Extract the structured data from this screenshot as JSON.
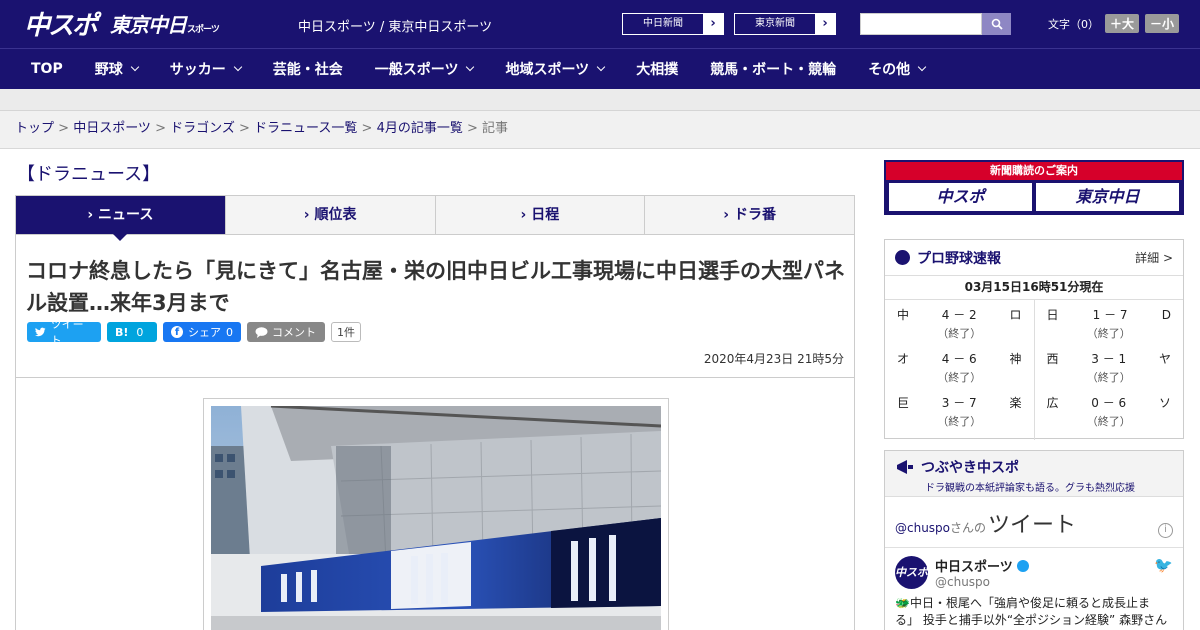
{
  "header": {
    "logo_main": "中スポ",
    "logo_sub": "東京中日",
    "logo_sub_small": "スポーツ",
    "site_links": "中日スポーツ / 東京中日スポーツ",
    "newspaper_btn_1": "中日新聞",
    "newspaper_btn_2": "東京新聞",
    "search_placeholder": "",
    "font_label": "文字（0）",
    "font_bigger": "＋大",
    "font_smaller": "－小"
  },
  "nav": {
    "items": [
      {
        "label": "TOP",
        "dropdown": false
      },
      {
        "label": "野球",
        "dropdown": true
      },
      {
        "label": "サッカー",
        "dropdown": true
      },
      {
        "label": "芸能・社会",
        "dropdown": false
      },
      {
        "label": "一般スポーツ",
        "dropdown": true
      },
      {
        "label": "地域スポーツ",
        "dropdown": true
      },
      {
        "label": "大相撲",
        "dropdown": false
      },
      {
        "label": "競馬・ボート・競輪",
        "dropdown": false
      },
      {
        "label": "その他",
        "dropdown": true
      }
    ]
  },
  "breadcrumb": [
    "トップ",
    "中日スポーツ",
    "ドラゴンズ",
    "ドラニュース一覧",
    "4月の記事一覧",
    "記事"
  ],
  "section_title": "【ドラニュース】",
  "tabs": [
    "ニュース",
    "順位表",
    "日程",
    "ドラ番"
  ],
  "article": {
    "headline": "コロナ終息したら「見にきて」名古屋・栄の旧中日ビル工事現場に中日選手の大型パネル設置…来年3月まで",
    "tweet_label": "ツイート",
    "hatena_label": "B!",
    "hatena_count": "0",
    "fb_label": "シェア",
    "fb_count": "0",
    "comment_label": "コメント",
    "comment_count": "1件",
    "date": "2020年4月23日 21時5分"
  },
  "sidebar": {
    "subscribe_banner": "新聞購読のご案内",
    "sub_btn_1": "中スポ",
    "sub_btn_2": "東京中日",
    "scores": {
      "title": "プロ野球速報",
      "more": "詳細 >",
      "time": "03月15日16時51分現在",
      "games": [
        [
          {
            "home": "中",
            "score": "4 － 2",
            "away": "ロ",
            "status": "（終了）"
          },
          {
            "home": "オ",
            "score": "4 － 6",
            "away": "神",
            "status": "（終了）"
          },
          {
            "home": "巨",
            "score": "3 － 7",
            "away": "楽",
            "status": "（終了）"
          }
        ],
        [
          {
            "home": "日",
            "score": "1 － 7",
            "away": "D",
            "status": "（終了）"
          },
          {
            "home": "西",
            "score": "3 － 1",
            "away": "ヤ",
            "status": "（終了）"
          },
          {
            "home": "広",
            "score": "0 － 6",
            "away": "ソ",
            "status": "（終了）"
          }
        ]
      ]
    },
    "tweets": {
      "title": "つぶやき中スポ",
      "subtitle": "ドラ観戦の本紙評論家も語る。グラも熱烈応援",
      "handle_line": "@chuspo",
      "handle_suffix": "さんの",
      "big_label": "ツイート",
      "info": "i",
      "user_name": "中日スポーツ",
      "user_handle": "@chuspo",
      "avatar_text": "中スポ",
      "text": "🐲中日・根尾へ「強肩や俊足に頼ると成長止まる」 投手と捕手以外“全ポジション経験” 森野さんか"
    }
  }
}
